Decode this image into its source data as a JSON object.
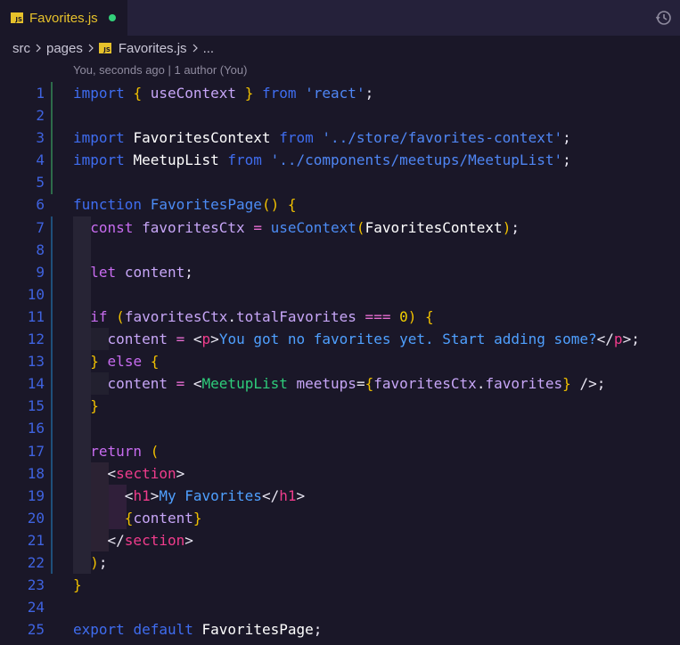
{
  "tab": {
    "file_name": "Favorites.js",
    "icon_text": "JS",
    "modified_dot": true
  },
  "breadcrumb": {
    "items": [
      "src",
      "pages",
      "Favorites.js",
      "..."
    ]
  },
  "blame": "You, seconds ago | 1 author (You)",
  "editor": {
    "line_numbers": [
      "1",
      "2",
      "3",
      "4",
      "5",
      "6",
      "7",
      "8",
      "9",
      "10",
      "11",
      "12",
      "13",
      "14",
      "15",
      "16",
      "17",
      "18",
      "19",
      "20",
      "21",
      "22",
      "23",
      "24",
      "25"
    ],
    "lines": [
      "import { useContext } from 'react';",
      "",
      "import FavoritesContext from '../store/favorites-context';",
      "import MeetupList from '../components/meetups/MeetupList';",
      "",
      "function FavoritesPage() {",
      "  const favoritesCtx = useContext(FavoritesContext);",
      "",
      "  let content;",
      "",
      "  if (favoritesCtx.totalFavorites === 0) {",
      "    content = <p>You got no favorites yet. Start adding some?</p>;",
      "  } else {",
      "    content = <MeetupList meetups={favoritesCtx.favorites} />;",
      "  }",
      "",
      "  return (",
      "    <section>",
      "      <h1>My Favorites</h1>",
      "      {content}",
      "    </section>",
      "  );",
      "}",
      "",
      "export default FavoritesPage;"
    ]
  },
  "colors": {
    "background": "#1a1728",
    "tab_bar": "#25213a",
    "line_number": "#3f63e0",
    "keyword": "#3f6df0",
    "tab_title": "#e6c12b",
    "modified_dot": "#33d17a"
  }
}
